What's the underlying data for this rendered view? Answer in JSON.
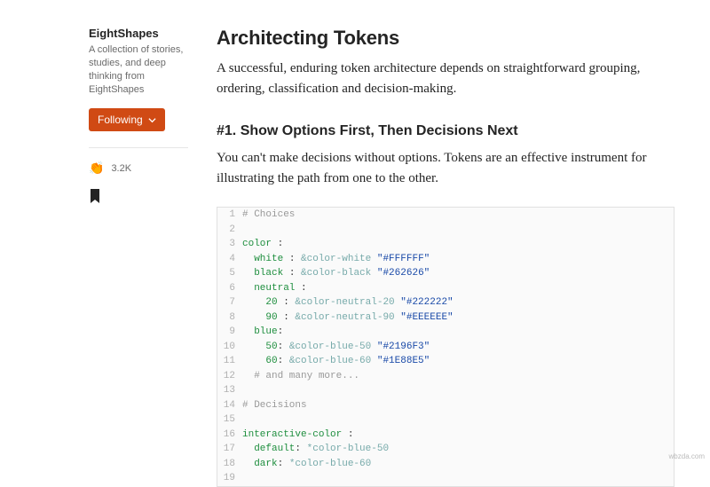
{
  "sidebar": {
    "publication": "EightShapes",
    "description": "A collection of stories, studies, and deep thinking from EightShapes",
    "follow_label": "Following",
    "clap_count": "3.2K"
  },
  "article": {
    "title": "Architecting Tokens",
    "lede": "A successful, enduring token architecture depends on straightforward grouping, ordering, classification and decision-making.",
    "section1_heading": "#1. Show Options First, Then Decisions Next",
    "section1_body": "You can't make decisions without options. Tokens are an effective instrument for illustrating the path from one to the other."
  },
  "code": {
    "lines": [
      {
        "n": 1,
        "tokens": [
          [
            "c-comment",
            "# Choices"
          ]
        ]
      },
      {
        "n": 2,
        "tokens": []
      },
      {
        "n": 3,
        "tokens": [
          [
            "c-key",
            "color"
          ],
          [
            "ln",
            " :"
          ]
        ]
      },
      {
        "n": 4,
        "tokens": [
          [
            "ln",
            "  "
          ],
          [
            "c-key",
            "white"
          ],
          [
            "ln",
            " : "
          ],
          [
            "c-anchor",
            "&color-white"
          ],
          [
            "ln",
            " "
          ],
          [
            "c-string",
            "\"#FFFFFF\""
          ]
        ]
      },
      {
        "n": 5,
        "tokens": [
          [
            "ln",
            "  "
          ],
          [
            "c-key",
            "black"
          ],
          [
            "ln",
            " : "
          ],
          [
            "c-anchor",
            "&color-black"
          ],
          [
            "ln",
            " "
          ],
          [
            "c-string",
            "\"#262626\""
          ]
        ]
      },
      {
        "n": 6,
        "tokens": [
          [
            "ln",
            "  "
          ],
          [
            "c-key",
            "neutral"
          ],
          [
            "ln",
            " :"
          ]
        ]
      },
      {
        "n": 7,
        "tokens": [
          [
            "ln",
            "    "
          ],
          [
            "c-key",
            "20"
          ],
          [
            "ln",
            " : "
          ],
          [
            "c-anchor",
            "&color-neutral-20"
          ],
          [
            "ln",
            " "
          ],
          [
            "c-string",
            "\"#222222\""
          ]
        ]
      },
      {
        "n": 8,
        "tokens": [
          [
            "ln",
            "    "
          ],
          [
            "c-key",
            "90"
          ],
          [
            "ln",
            " : "
          ],
          [
            "c-anchor",
            "&color-neutral-90"
          ],
          [
            "ln",
            " "
          ],
          [
            "c-string",
            "\"#EEEEEE\""
          ]
        ]
      },
      {
        "n": 9,
        "tokens": [
          [
            "ln",
            "  "
          ],
          [
            "c-key",
            "blue"
          ],
          [
            "ln",
            ":"
          ]
        ]
      },
      {
        "n": 10,
        "tokens": [
          [
            "ln",
            "    "
          ],
          [
            "c-key",
            "50"
          ],
          [
            "ln",
            ": "
          ],
          [
            "c-anchor",
            "&color-blue-50"
          ],
          [
            "ln",
            " "
          ],
          [
            "c-string",
            "\"#2196F3\""
          ]
        ]
      },
      {
        "n": 11,
        "tokens": [
          [
            "ln",
            "    "
          ],
          [
            "c-key",
            "60"
          ],
          [
            "ln",
            ": "
          ],
          [
            "c-anchor",
            "&color-blue-60"
          ],
          [
            "ln",
            " "
          ],
          [
            "c-string",
            "\"#1E88E5\""
          ]
        ]
      },
      {
        "n": 12,
        "tokens": [
          [
            "ln",
            "  "
          ],
          [
            "c-comment",
            "# and many more..."
          ]
        ]
      },
      {
        "n": 13,
        "tokens": []
      },
      {
        "n": 14,
        "tokens": [
          [
            "c-comment",
            "# Decisions"
          ]
        ]
      },
      {
        "n": 15,
        "tokens": []
      },
      {
        "n": 16,
        "tokens": [
          [
            "c-key",
            "interactive-color"
          ],
          [
            "ln",
            " :"
          ]
        ]
      },
      {
        "n": 17,
        "tokens": [
          [
            "ln",
            "  "
          ],
          [
            "c-key",
            "default"
          ],
          [
            "ln",
            ": "
          ],
          [
            "c-anchor",
            "*color-blue-50"
          ]
        ]
      },
      {
        "n": 18,
        "tokens": [
          [
            "ln",
            "  "
          ],
          [
            "c-key",
            "dark"
          ],
          [
            "ln",
            ": "
          ],
          [
            "c-anchor",
            "*color-blue-60"
          ]
        ]
      },
      {
        "n": 19,
        "tokens": []
      }
    ]
  },
  "watermark": "wbzda.com"
}
